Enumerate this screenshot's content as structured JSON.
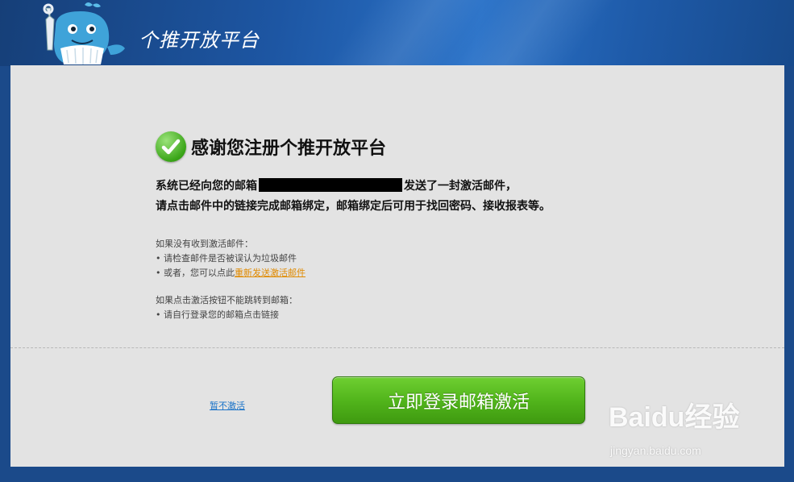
{
  "header": {
    "brand_title": "个推开放平台"
  },
  "main": {
    "success_title": "感谢您注册个推开放平台",
    "message_line1_before": "系统已经向您的邮箱",
    "message_line1_after": "发送了一封激活邮件，",
    "message_line2": "请点击邮件中的链接完成邮箱绑定，邮箱绑定后可用于找回密码、接收报表等。",
    "help1_heading": "如果没有收到激活邮件：",
    "help1_item1": "• 请检查邮件是否被误认为垃圾邮件",
    "help1_item2_prefix": "• 或者，您可以点此",
    "resend_link": "重新发送激活邮件",
    "help2_heading": "如果点击激活按钮不能跳转到邮箱：",
    "help2_item1": "• 请自行登录您的邮箱点击链接"
  },
  "actions": {
    "skip_label": "暂不激活",
    "activate_label": "立即登录邮箱激活"
  },
  "watermark": {
    "logo_text": "Baidu经验",
    "url": "jingyan.baidu.com"
  },
  "colors": {
    "header_blue": "#1d56a3",
    "panel_gray": "#e3e3e3",
    "button_green": "#52b51c",
    "link_orange": "#e08a00",
    "link_blue": "#1a73c8"
  }
}
